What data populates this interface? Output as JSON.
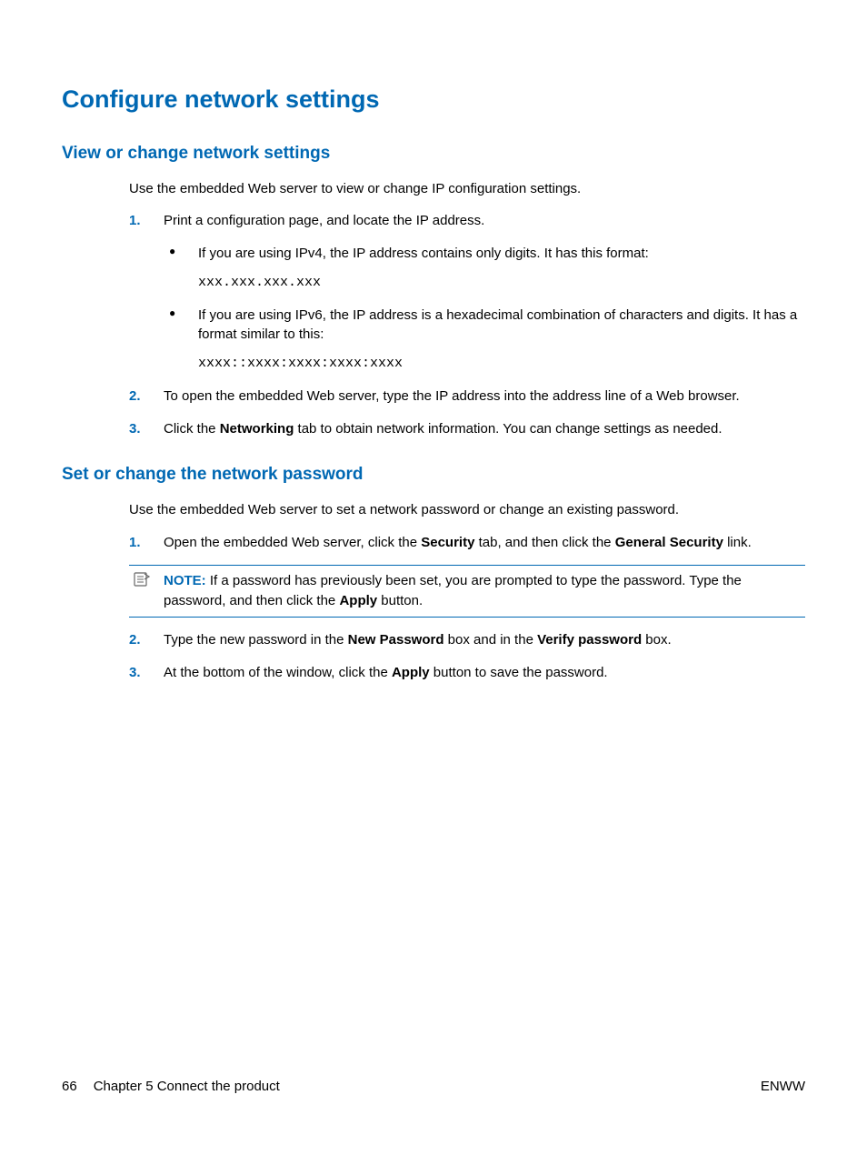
{
  "title": "Configure network settings",
  "section1": {
    "heading": "View or change network settings",
    "intro": "Use the embedded Web server to view or change IP configuration settings.",
    "step1": {
      "num": "1.",
      "text": "Print a configuration page, and locate the IP address.",
      "bullet1": "If you are using IPv4, the IP address contains only digits. It has this format:",
      "code1": "xxx.xxx.xxx.xxx",
      "bullet2": "If you are using IPv6, the IP address is a hexadecimal combination of characters and digits. It has a format similar to this:",
      "code2": "xxxx::xxxx:xxxx:xxxx:xxxx"
    },
    "step2": {
      "num": "2.",
      "text": "To open the embedded Web server, type the IP address into the address line of a Web browser."
    },
    "step3": {
      "num": "3.",
      "pre": "Click the ",
      "bold": "Networking",
      "post": " tab to obtain network information. You can change settings as needed."
    }
  },
  "section2": {
    "heading": "Set or change the network password",
    "intro": "Use the embedded Web server to set a network password or change an existing password.",
    "step1": {
      "num": "1.",
      "t1": "Open the embedded Web server, click the ",
      "b1": "Security",
      "t2": " tab, and then click the ",
      "b2": "General Security",
      "t3": " link."
    },
    "note": {
      "label": "NOTE:",
      "t1": " If a password has previously been set, you are prompted to type the password. Type the password, and then click the ",
      "b1": "Apply",
      "t2": " button."
    },
    "step2": {
      "num": "2.",
      "t1": "Type the new password in the ",
      "b1": "New Password",
      "t2": " box and in the ",
      "b2": "Verify password",
      "t3": " box."
    },
    "step3": {
      "num": "3.",
      "t1": "At the bottom of the window, click the ",
      "b1": "Apply",
      "t2": " button to save the password."
    }
  },
  "footer": {
    "page": "66",
    "chapter": "Chapter 5   Connect the product",
    "lang": "ENWW"
  }
}
